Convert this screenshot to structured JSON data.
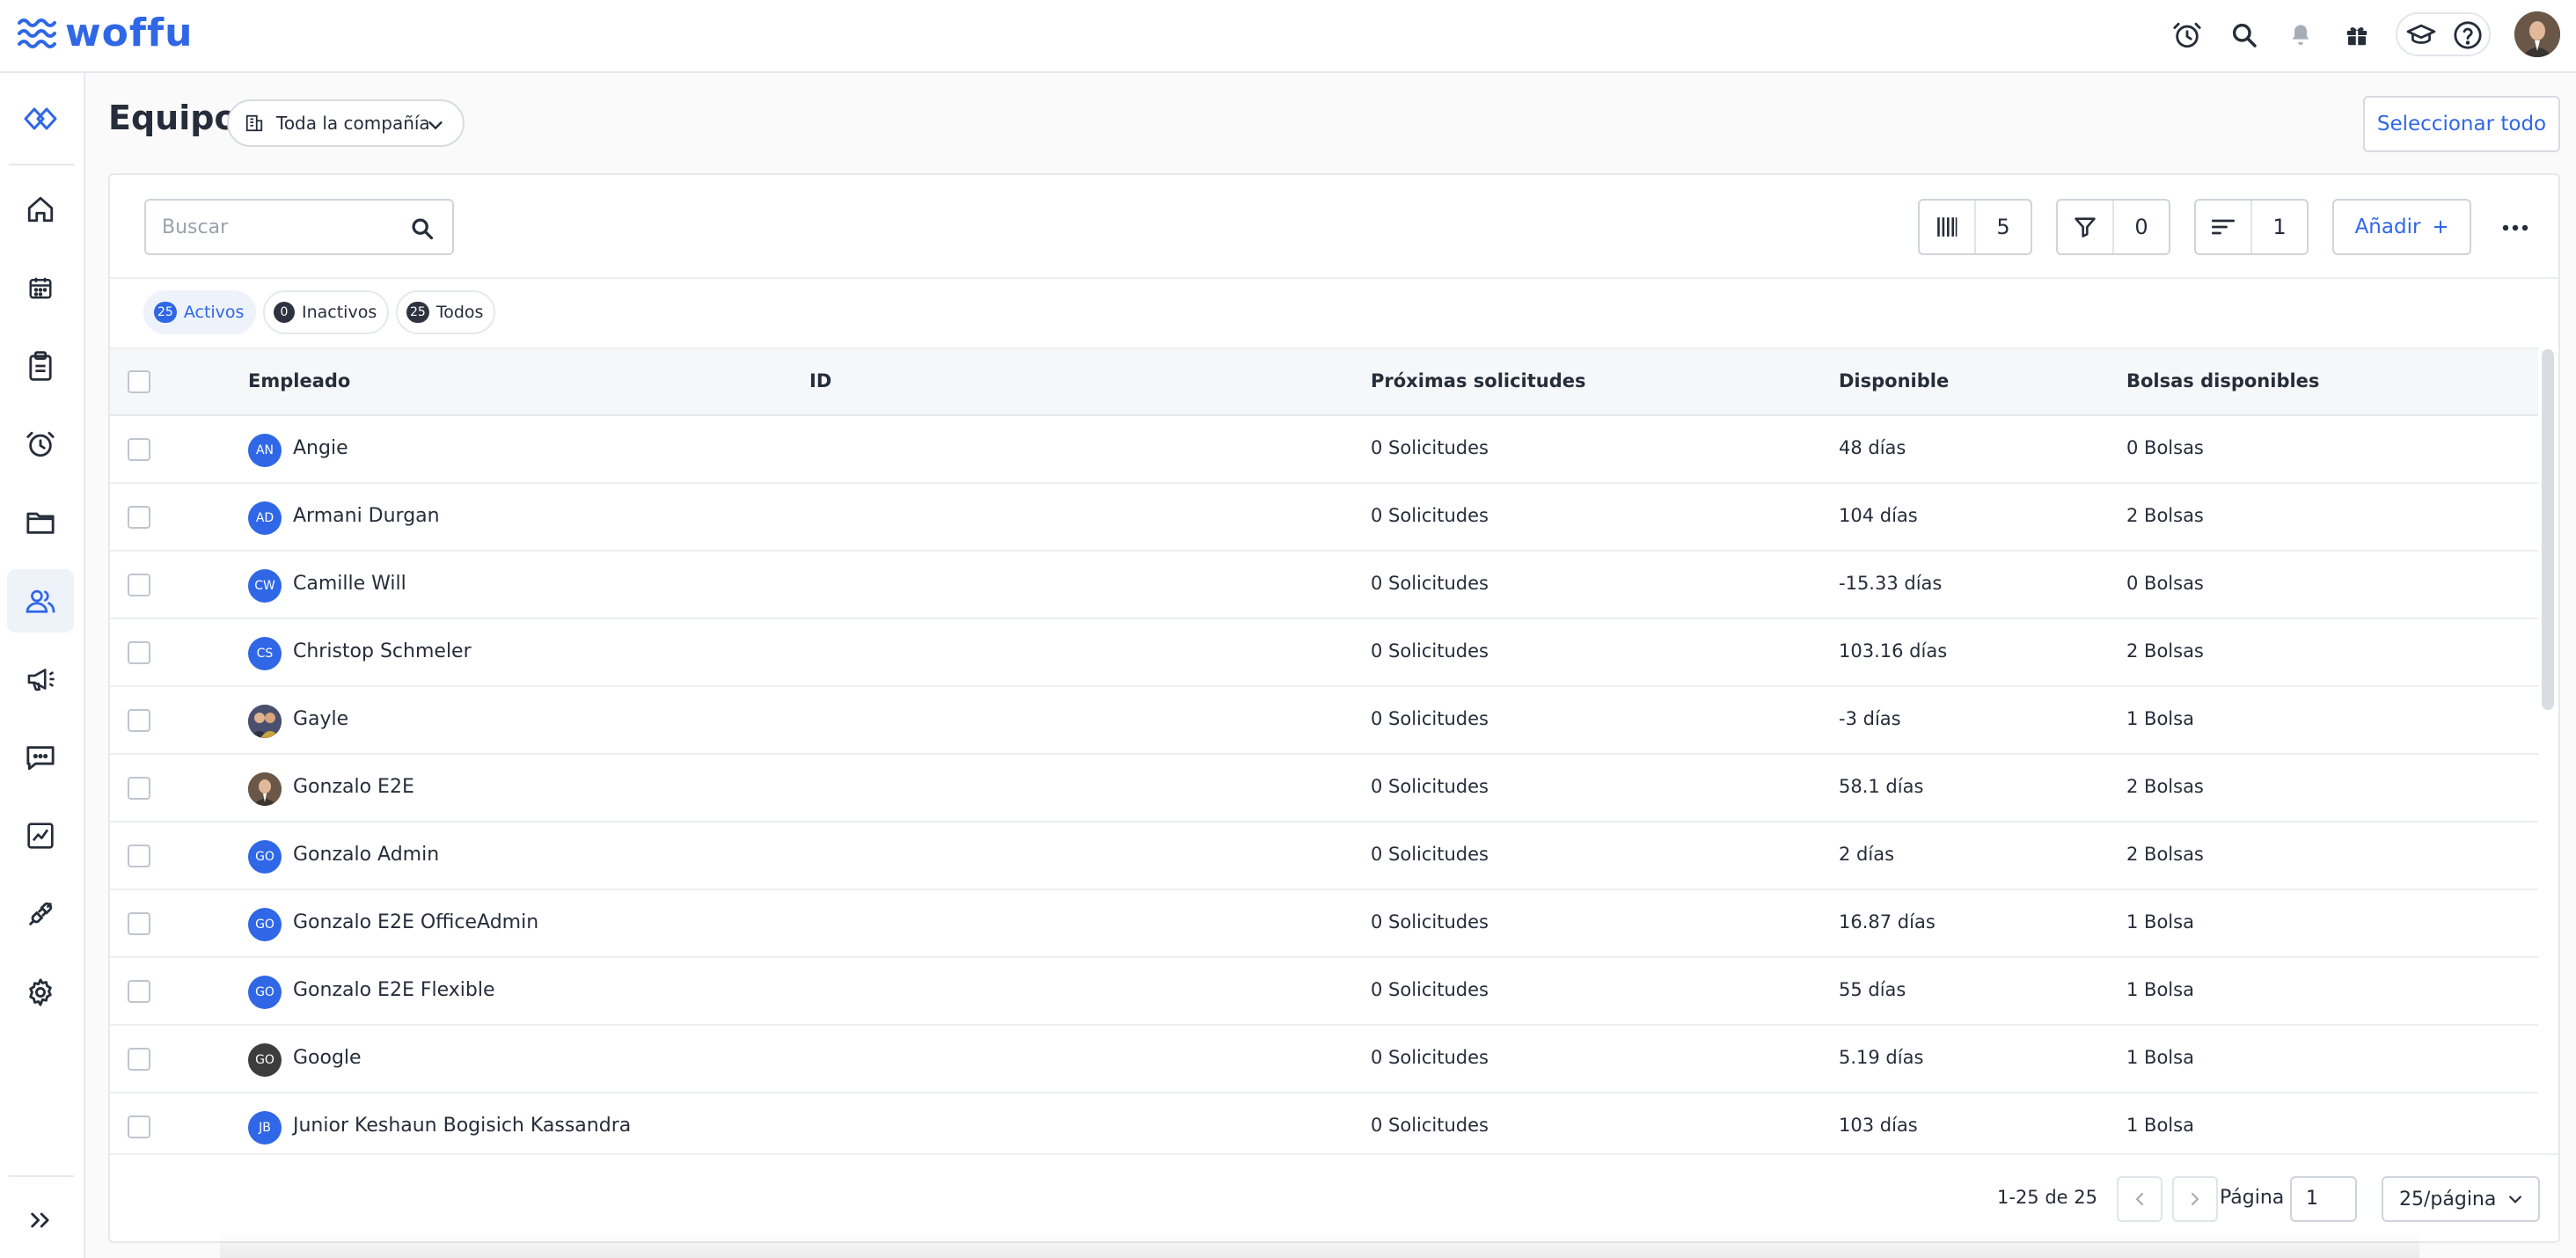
{
  "app": {
    "logo_text": "woffu"
  },
  "header": {
    "title": "Equipo",
    "company_filter": "Toda la compañía",
    "select_all_label": "Seleccionar todo"
  },
  "toolbar": {
    "search_placeholder": "Buscar",
    "columns_count": "5",
    "filters_count": "0",
    "sort_count": "1",
    "add_label": "Añadir"
  },
  "status_tabs": [
    {
      "count": "25",
      "label": "Activos",
      "active": true
    },
    {
      "count": "0",
      "label": "Inactivos",
      "active": false
    },
    {
      "count": "25",
      "label": "Todos",
      "active": false
    }
  ],
  "table": {
    "columns": [
      "Empleado",
      "ID",
      "Próximas solicitudes",
      "Disponible",
      "Bolsas disponibles"
    ],
    "rows": [
      {
        "initials": "AN",
        "name": "Angie",
        "id": "",
        "requests": "0 Solicitudes",
        "available": "48 días",
        "bags": "0 Bolsas",
        "avatar": "initials",
        "color": "#2f67e6"
      },
      {
        "initials": "AD",
        "name": "Armani Durgan",
        "id": "",
        "requests": "0 Solicitudes",
        "available": "104 días",
        "bags": "2 Bolsas",
        "avatar": "initials",
        "color": "#2f67e6"
      },
      {
        "initials": "CW",
        "name": "Camille Will",
        "id": "",
        "requests": "0 Solicitudes",
        "available": "-15.33 días",
        "bags": "0 Bolsas",
        "avatar": "initials",
        "color": "#2f67e6"
      },
      {
        "initials": "CS",
        "name": "Christop Schmeler",
        "id": "",
        "requests": "0 Solicitudes",
        "available": "103.16 días",
        "bags": "2 Bolsas",
        "avatar": "initials",
        "color": "#2f67e6"
      },
      {
        "initials": "",
        "name": "Gayle",
        "id": "",
        "requests": "0 Solicitudes",
        "available": "-3 días",
        "bags": "1 Bolsa",
        "avatar": "photo-group",
        "color": "#3b3f5c"
      },
      {
        "initials": "",
        "name": "Gonzalo E2E",
        "id": "",
        "requests": "0 Solicitudes",
        "available": "58.1 días",
        "bags": "2 Bolsas",
        "avatar": "photo-person",
        "color": "#5a4a3c"
      },
      {
        "initials": "GO",
        "name": "Gonzalo Admin",
        "id": "",
        "requests": "0 Solicitudes",
        "available": "2 días",
        "bags": "2 Bolsas",
        "avatar": "initials",
        "color": "#2f67e6"
      },
      {
        "initials": "GO",
        "name": "Gonzalo E2E OfficeAdmin",
        "id": "",
        "requests": "0 Solicitudes",
        "available": "16.87 días",
        "bags": "1 Bolsa",
        "avatar": "initials",
        "color": "#2f67e6"
      },
      {
        "initials": "GO",
        "name": "Gonzalo E2E Flexible",
        "id": "",
        "requests": "0 Solicitudes",
        "available": "55 días",
        "bags": "1 Bolsa",
        "avatar": "initials",
        "color": "#2f67e6"
      },
      {
        "initials": "GO",
        "name": "Google",
        "id": "",
        "requests": "0 Solicitudes",
        "available": "5.19 días",
        "bags": "1 Bolsa",
        "avatar": "initials",
        "color": "#3d3d3d"
      },
      {
        "initials": "JB",
        "name": "Junior Keshaun Bogisich Kassandra",
        "id": "",
        "requests": "0 Solicitudes",
        "available": "103 días",
        "bags": "1 Bolsa",
        "avatar": "initials",
        "color": "#2f67e6"
      }
    ]
  },
  "pagination": {
    "range": "1-25 de 25",
    "page_label": "Página",
    "page_value": "1",
    "page_size": "25/página"
  },
  "sidebar": {
    "items": [
      {
        "name": "woffu-diamond-icon"
      },
      {
        "name": "home-icon"
      },
      {
        "name": "calendar-icon"
      },
      {
        "name": "clipboard-icon"
      },
      {
        "name": "alarm-clock-icon"
      },
      {
        "name": "folder-icon"
      },
      {
        "name": "team-icon"
      },
      {
        "name": "megaphone-icon"
      },
      {
        "name": "chat-icon"
      },
      {
        "name": "chart-icon"
      },
      {
        "name": "plug-icon"
      },
      {
        "name": "gear-icon"
      }
    ],
    "expand_icon": "double-chevron-right-icon"
  },
  "colors": {
    "brand": "#2f67e6",
    "text": "#262d3a",
    "border": "#d7dbe1"
  }
}
